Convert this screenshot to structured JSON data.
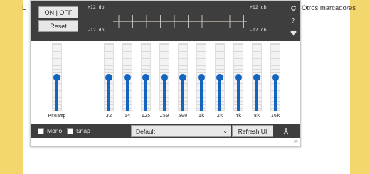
{
  "browser": {
    "left_bookmark": "L",
    "bookmarks_text": "Otros marcadores"
  },
  "equalizer": {
    "onoff_label": "ON | OFF",
    "reset_label": "Reset",
    "db_top_left": "+12 db",
    "db_bottom_left": "-12 db",
    "db_top_right": "+12 db",
    "db_bottom_right": "-12 db",
    "side_icons": [
      "refresh-icon",
      "help-icon",
      "heart-icon"
    ],
    "preamp_label": "Preamp",
    "bands": [
      {
        "label": "32",
        "value_db": 0
      },
      {
        "label": "64",
        "value_db": 0
      },
      {
        "label": "125",
        "value_db": 0
      },
      {
        "label": "250",
        "value_db": 0
      },
      {
        "label": "500",
        "value_db": 0
      },
      {
        "label": "1k",
        "value_db": 0
      },
      {
        "label": "2k",
        "value_db": 0
      },
      {
        "label": "4k",
        "value_db": 0
      },
      {
        "label": "8k",
        "value_db": 0
      },
      {
        "label": "16k",
        "value_db": 0
      }
    ],
    "preamp_value_db": 0,
    "mono_label": "Mono",
    "snap_label": "Snap",
    "preset_selected": "Default",
    "refresh_ui_label": "Refresh UI",
    "accent_color": "#1565c0",
    "panel_color": "#3e3e3e"
  }
}
